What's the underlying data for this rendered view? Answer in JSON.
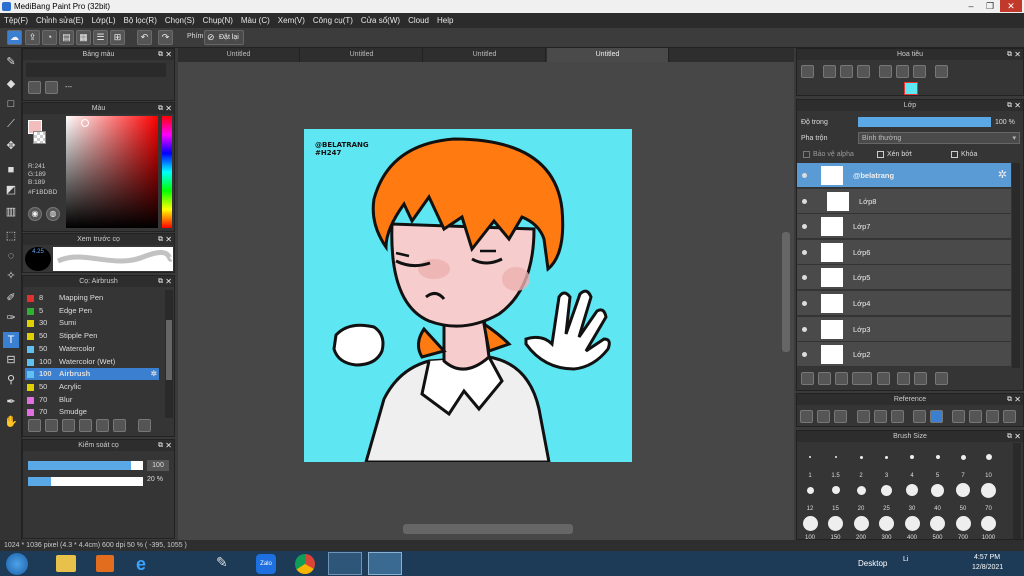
{
  "window": {
    "title": "MediBang Paint Pro (32bit)"
  },
  "menu": [
    "Tệp(F)",
    "Chỉnh sửa(E)",
    "Lớp(L)",
    "Bộ lọc(R)",
    "Chọn(S)",
    "Chụp(N)",
    "Màu (C)",
    "Xem(V)",
    "Công cụ(T)",
    "Cửa sổ(W)",
    "Cloud",
    "Help"
  ],
  "toolbar": {
    "keys_label": "Phím",
    "reset_label": "Đặt lại"
  },
  "tabs": [
    "Untitled",
    "Untitled",
    "Untitled",
    "Untitled"
  ],
  "panels": {
    "palette": {
      "title": "Bảng màu",
      "placeholder": "---"
    },
    "color": {
      "title": "Màu",
      "r": "R:241",
      "g": "G:189",
      "b": "B:189",
      "hex": "#F1BDBD",
      "fg": "#F1BDBD"
    },
    "preview": {
      "title": "Xem trước cọ",
      "size": "4.25"
    },
    "brush": {
      "title": "Cọ: Airbrush",
      "items": [
        {
          "num": "8",
          "name": "Mapping Pen",
          "color": "#e03030"
        },
        {
          "num": "5",
          "name": "Edge Pen",
          "color": "#30b030"
        },
        {
          "num": "30",
          "name": "Sumi",
          "color": "#e0d000"
        },
        {
          "num": "50",
          "name": "Stipple Pen",
          "color": "#e0d000"
        },
        {
          "num": "50",
          "name": "Watercolor",
          "color": "#60c0f0"
        },
        {
          "num": "100",
          "name": "Watercolor (Wet)",
          "color": "#60c0f0"
        },
        {
          "num": "100",
          "name": "Airbrush",
          "color": "#60c0f0"
        },
        {
          "num": "50",
          "name": "Acrylic",
          "color": "#e0d000"
        },
        {
          "num": "70",
          "name": "Blur",
          "color": "#e070e0"
        },
        {
          "num": "70",
          "name": "Smudge",
          "color": "#e070e0"
        }
      ]
    },
    "control": {
      "title": "Kiểm soát cọ",
      "size": "100",
      "opacity": "20 %"
    },
    "navigator": {
      "title": "Hoa tiêu"
    },
    "layer": {
      "title": "Lớp",
      "opacity_label": "Độ trong",
      "opacity_value": "100 %",
      "blend_label": "Pha trộn",
      "blend_value": "Bình thường",
      "protect_alpha": "Bảo vệ alpha",
      "clip": "Xén bớt",
      "lock": "Khóa",
      "layers": [
        "@belatrang",
        "Lớp8",
        "Lớp7",
        "Lớp6",
        "Lớp5",
        "Lớp4",
        "Lớp3",
        "Lớp2"
      ]
    },
    "reference": {
      "title": "Reference"
    },
    "brushsize": {
      "title": "Brush Size",
      "row1": [
        "1",
        "1.5",
        "2",
        "3",
        "4",
        "5",
        "7",
        "10"
      ],
      "row2": [
        "12",
        "15",
        "20",
        "25",
        "30",
        "40",
        "50",
        "70"
      ],
      "row3": [
        "100",
        "150",
        "200",
        "300",
        "400",
        "500",
        "700",
        "1000"
      ]
    }
  },
  "artwork": {
    "watermark1": "@BELATRANG",
    "watermark2": "#H247"
  },
  "status": {
    "text": "1024 * 1036 pixel  (4.3 * 4.4cm)  600 dpi  50 %  ( -395, 1055 )"
  },
  "taskbar": {
    "desktop": "Desktop",
    "time": "4:57 PM",
    "date": "12/8/2021",
    "lang": "Li"
  }
}
